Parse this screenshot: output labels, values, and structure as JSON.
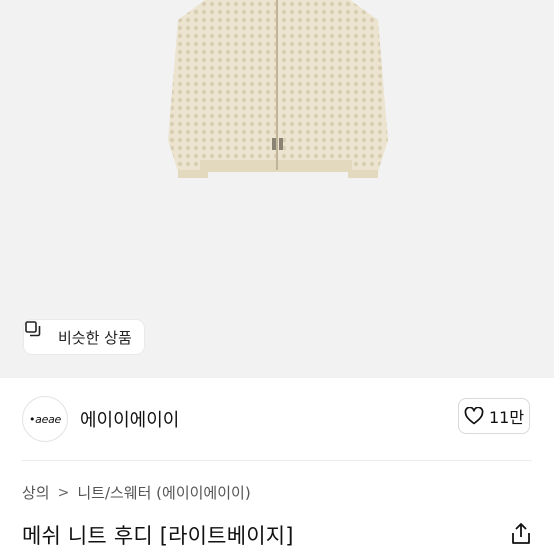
{
  "product": {
    "similar_button_label": "비슷한 상품",
    "title": "메쉬 니트 후디 [라이트베이지]"
  },
  "shop": {
    "logo_text": "•aeae",
    "name": "에이이에이이",
    "like_count": "11만"
  },
  "breadcrumb": {
    "category": "상의",
    "separator": ">",
    "subcategory": "니트/스웨터 (에이이에이이)"
  },
  "icons": {
    "similar": "stacked-squares-icon",
    "like": "heart-outline-icon",
    "share": "share-icon"
  },
  "colors": {
    "hero_background": "#f2f2f2",
    "garment": "#ece4cf"
  }
}
